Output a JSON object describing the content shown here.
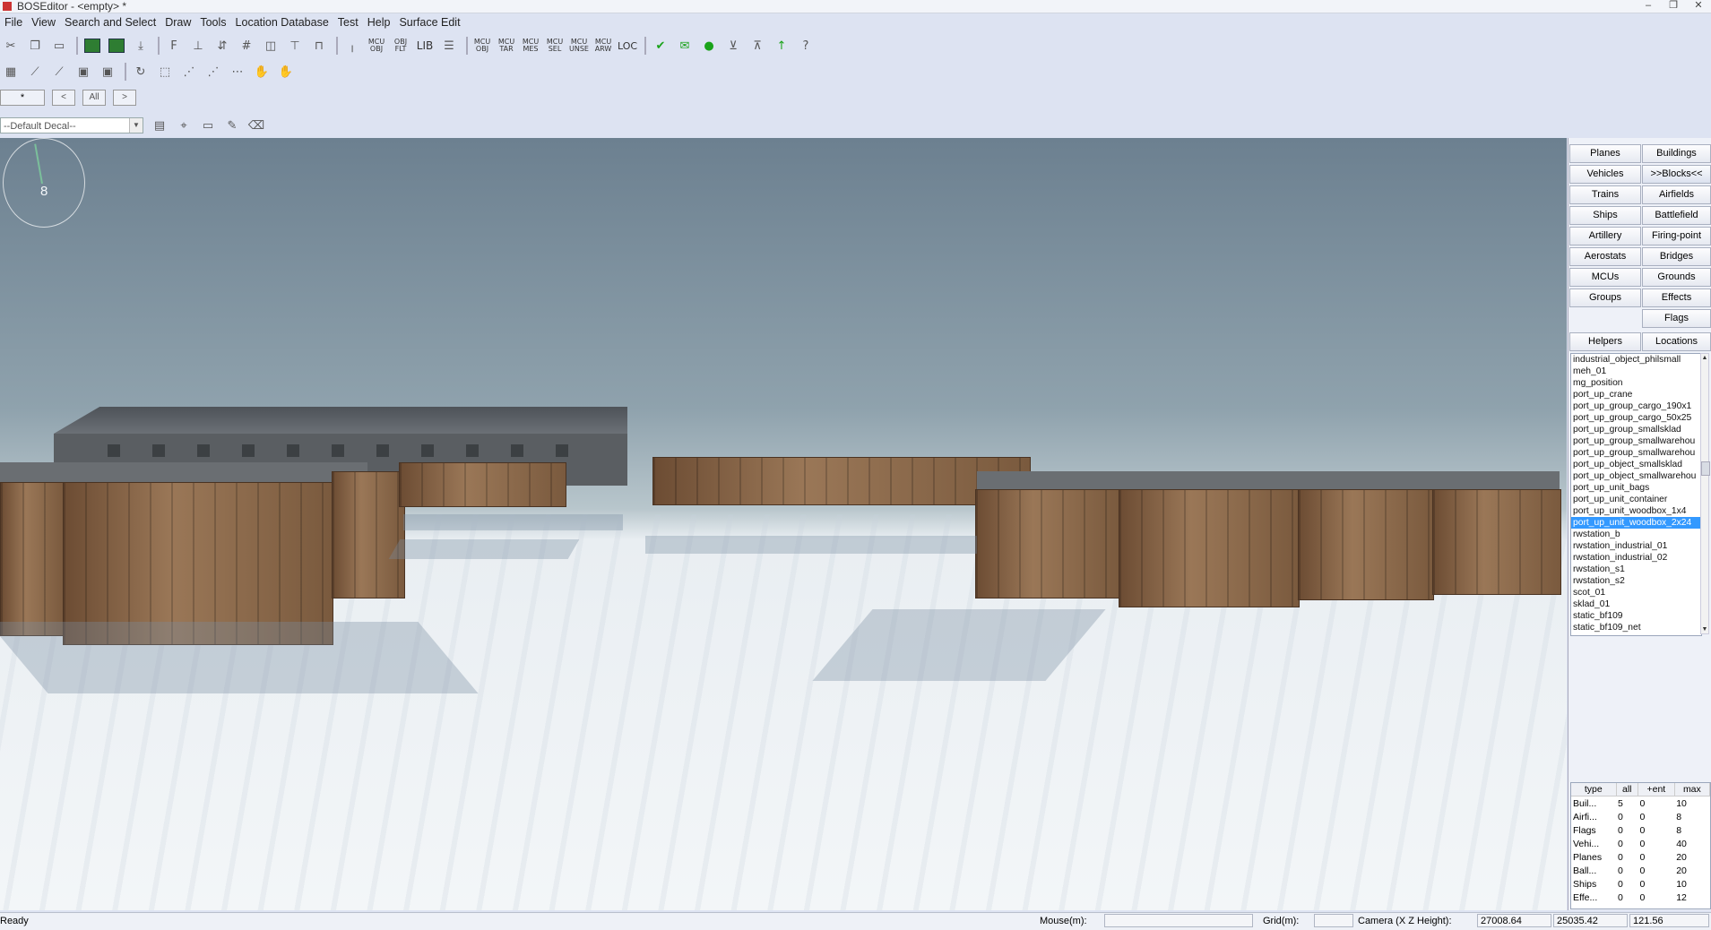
{
  "window": {
    "title": "BOSEditor - <empty> *",
    "buttons": [
      "–",
      "❐",
      "✕"
    ]
  },
  "menu": [
    "File",
    "View",
    "Search and Select",
    "Draw",
    "Tools",
    "Location Database",
    "Test",
    "Help",
    "Surface Edit"
  ],
  "toolbar1": {
    "text_buttons": {
      "mcu_obj": "MCU OBJ",
      "obj_filter": "OBJ FLT",
      "lib": "LIB",
      "mcu_obj2": "MCU OBJ",
      "mcu_tar": "MCU TAR",
      "mcu_mes": "MCU MES",
      "mcu_sel": "MCU SEL",
      "mcu_unse": "MCU UNSE",
      "mcu_arw": "MCU ARW",
      "loc": "LOC"
    }
  },
  "toolbar3": {
    "group_field": "*",
    "prev": "<",
    "all": "All",
    "next": ">"
  },
  "decal_select": {
    "value": "--Default Decal--"
  },
  "compass": {
    "label": "8"
  },
  "categories": {
    "left": [
      "Planes",
      "Vehicles",
      "Trains",
      "Ships",
      "Artillery",
      "Aerostats",
      "MCUs",
      "Groups"
    ],
    "right": [
      "Buildings",
      ">>Blocks<<",
      "Airfields",
      "Battlefield",
      "Firing-point",
      "Bridges",
      "Grounds",
      "Effects",
      "Flags"
    ],
    "helpers": "Helpers",
    "locations": "Locations"
  },
  "object_list": {
    "items": [
      "industrial_object_philsmall",
      "meh_01",
      "mg_position",
      "port_up_crane",
      "port_up_group_cargo_190x1",
      "port_up_group_cargo_50x25",
      "port_up_group_smallsklad",
      "port_up_group_smallwarehou",
      "port_up_group_smallwarehou",
      "port_up_object_smallsklad",
      "port_up_object_smallwarehou",
      "port_up_unit_bags",
      "port_up_unit_container",
      "port_up_unit_woodbox_1x4",
      "port_up_unit_woodbox_2x24",
      "rwstation_b",
      "rwstation_industrial_01",
      "rwstation_industrial_02",
      "rwstation_s1",
      "rwstation_s2",
      "scot_01",
      "sklad_01",
      "static_bf109",
      "static_bf109_net"
    ],
    "selected": "port_up_unit_woodbox_2x24"
  },
  "stats": {
    "headers": [
      "type",
      "all",
      "+ent",
      "max"
    ],
    "rows": [
      [
        "Buil...",
        "5",
        "0",
        "10"
      ],
      [
        "Airfi...",
        "0",
        "0",
        "8"
      ],
      [
        "Flags",
        "0",
        "0",
        "8"
      ],
      [
        "Vehi...",
        "0",
        "0",
        "40"
      ],
      [
        "Planes",
        "0",
        "0",
        "20"
      ],
      [
        "Ball...",
        "0",
        "0",
        "20"
      ],
      [
        "Ships",
        "0",
        "0",
        "10"
      ],
      [
        "Effe...",
        "0",
        "0",
        "12"
      ]
    ]
  },
  "status": {
    "state": "Ready",
    "mouse_label": "Mouse(m):",
    "grid_label": "Grid(m):",
    "camera_label": "Camera (X Z Height):",
    "camera_x": "27008.64",
    "camera_z": "25035.42",
    "camera_h": "121.56"
  }
}
